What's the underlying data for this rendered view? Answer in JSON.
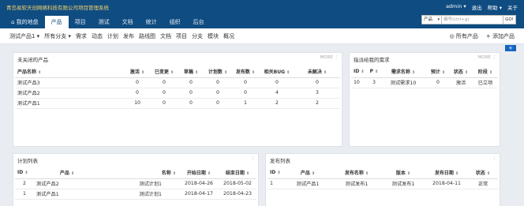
{
  "header": {
    "company": "青岛易软天创网络科技有限公司项目管理系统",
    "user_menu": [
      "admin ▾",
      "退出",
      "帮助 ▾",
      "关于"
    ],
    "tabs": [
      {
        "label": "⌂ 我的地盘",
        "active": false
      },
      {
        "label": "产品",
        "active": true
      },
      {
        "label": "项目",
        "active": false
      },
      {
        "label": "测试",
        "active": false
      },
      {
        "label": "文档",
        "active": false
      },
      {
        "label": "统计",
        "active": false
      },
      {
        "label": "组织",
        "active": false
      },
      {
        "label": "后台",
        "active": false
      }
    ],
    "search": {
      "scope": "产品",
      "placeholder": "编号(ctrl+g)",
      "go_label": "GO!"
    }
  },
  "subnav": {
    "items": [
      "测试产品1 ▾",
      "所有分支 ▾",
      "需求",
      "动态",
      "计划",
      "发布",
      "路线图",
      "文档",
      "项目",
      "分支",
      "模块",
      "概况"
    ],
    "right": [
      "◎ 所有产品",
      "+ 添加产品"
    ],
    "plus": "+"
  },
  "unclosed_products": {
    "title": "未关闭的产品",
    "more": "MORE ⋮",
    "columns": [
      "产品名称",
      "激活",
      "已变更",
      "草稿",
      "计划数",
      "发布数",
      "相关BUG",
      "未解决"
    ],
    "rows": [
      [
        "测试产品3",
        "0",
        "0",
        "0",
        "0",
        "0",
        "0",
        "0"
      ],
      [
        "测试产品2",
        "0",
        "0",
        "0",
        "0",
        "0",
        "4",
        "3"
      ],
      [
        "测试产品1",
        "10",
        "0",
        "0",
        "0",
        "1",
        "2",
        "2"
      ]
    ]
  },
  "assigned_stories": {
    "title": "指派给我的需求",
    "more": "MORE ⋮",
    "columns": [
      "ID",
      "P",
      "需求名称",
      "预计",
      "状态",
      "阶段"
    ],
    "rows": [
      [
        "10",
        "3",
        "测试需求10",
        "0",
        "激活",
        "已立项"
      ]
    ]
  },
  "plan_list": {
    "title": "计划列表",
    "more": "⋮",
    "columns": [
      "ID",
      "产品",
      "名称",
      "开始日期",
      "结束日期"
    ],
    "rows": [
      [
        "2",
        "测试产品2",
        "测试计划1",
        "2018-04-26",
        "2018-05-02"
      ],
      [
        "1",
        "测试产品1",
        "测试计划1",
        "2018-04-17",
        "2018-04-23"
      ]
    ]
  },
  "release_list": {
    "title": "发布列表",
    "more": "⋮",
    "columns": [
      "ID",
      "产品",
      "发布名称",
      "版本",
      "发布日期",
      "状态"
    ],
    "rows": [
      [
        "1",
        "测试产品1",
        "测试发布1",
        "测试发布1",
        "2018-04-11",
        "正常"
      ]
    ]
  },
  "sort_icon": "sort-icon",
  "colors": {
    "header_bg": "#0f4c81",
    "company_text": "#f5d36a",
    "accent": "#1565c0"
  }
}
